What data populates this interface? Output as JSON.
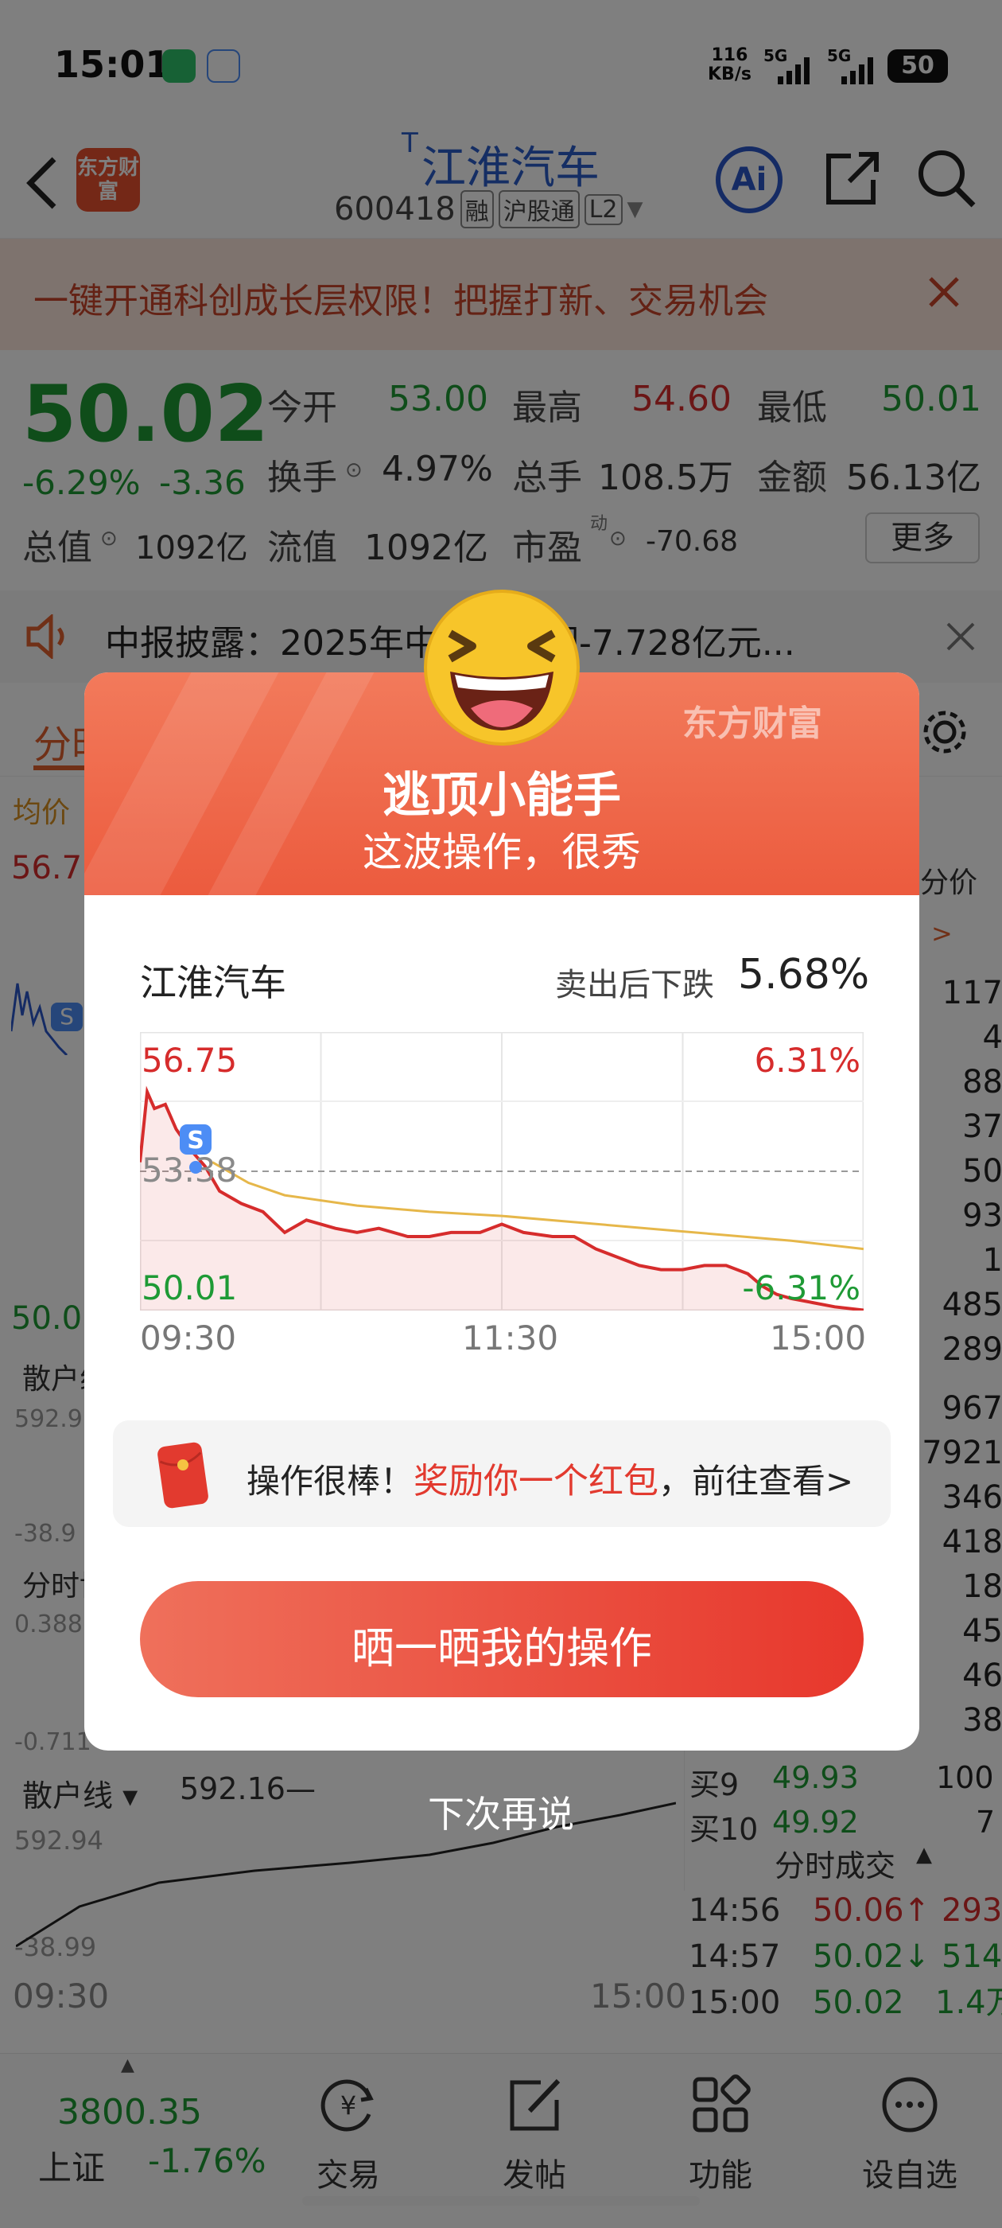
{
  "status_bar": {
    "time": "15:01",
    "net_speed_value": "116",
    "net_speed_unit": "KB/s",
    "signal1": "5G",
    "signal2": "5G",
    "battery": "50"
  },
  "header": {
    "logo_text": "东方财富",
    "title_prefix": "T",
    "title": "江淮汽车",
    "code": "600418",
    "badge1": "融",
    "badge2": "沪股通",
    "badge3": "L2"
  },
  "banner": {
    "text": "一键开通科创成长层权限！把握打新、交易机会"
  },
  "quote": {
    "price": "50.02",
    "change_pct": "-6.29%",
    "change_val": "-3.36",
    "open_label": "今开",
    "open": "53.00",
    "high_label": "最高",
    "high": "54.60",
    "low_label": "最低",
    "low": "50.01",
    "turnover_label": "换手",
    "turnover": "4.97%",
    "volume_label": "总手",
    "volume": "108.5万",
    "amount_label": "金额",
    "amount": "56.13亿",
    "mktcap_label": "总值",
    "mktcap": "1092亿",
    "float_label": "流值",
    "float_cap": "1092亿",
    "pe_label": "市盈",
    "pe_sup": "动",
    "pe": "-70.68",
    "more": "更多"
  },
  "notice": {
    "text": "中报披露：2025年中报净利润-7.728亿元..."
  },
  "background_panel": {
    "tab_left": "分时",
    "avg_price": "均价",
    "level_high": "56.7",
    "level_low": "50.0",
    "retail": "散户线",
    "level_592": "592.9",
    "level_neg38": "-38.9",
    "game": "分时博",
    "level_0388": "0.388",
    "level_neg0711": "-0.711",
    "retail_line_label": "散户线 ▾",
    "retail_line_value": "592.16—",
    "retail_top": "592.94",
    "retail_bottom": "-38.99",
    "time_start": "09:30",
    "time_end": "15:00",
    "right_header": "分价",
    "right_arrow": ">",
    "right_values": [
      "117",
      "4",
      "88",
      "37",
      "50",
      "93",
      "1",
      "485",
      "289",
      "967",
      "7921",
      "346",
      "418",
      "18",
      "45",
      "46",
      "38"
    ],
    "buy9_label": "买9",
    "buy9_price": "49.93",
    "buy9_vol": "100",
    "buy10_label": "买10",
    "buy10_price": "49.92",
    "buy10_vol": "7",
    "ticks_title": "分时成交",
    "ticks": [
      {
        "time": "14:56",
        "price": "50.06",
        "dir": "↑",
        "vol": "293"
      },
      {
        "time": "14:57",
        "price": "50.02",
        "dir": "↓",
        "vol": "514"
      },
      {
        "time": "15:00",
        "price": "50.02",
        "dir": "",
        "vol": "1.4万"
      }
    ]
  },
  "bottom_nav": {
    "index_value": "3800.35",
    "index_name": "上证",
    "index_change": "-1.76%",
    "items": [
      {
        "label": "交易",
        "icon": "yen-refresh-icon"
      },
      {
        "label": "发帖",
        "icon": "edit-post-icon"
      },
      {
        "label": "功能",
        "icon": "grid-apps-icon"
      },
      {
        "label": "设自选",
        "icon": "more-dots-icon"
      }
    ]
  },
  "modal": {
    "brand": "东方财富",
    "title": "逃顶小能手",
    "subtitle": "这波操作，很秀",
    "stock_name": "江淮汽车",
    "drop_label": "卖出后下跌",
    "drop_value": "5.68%",
    "chart_top_left": "56.75",
    "chart_top_right": "6.31%",
    "chart_mid_left": "53.38",
    "chart_bottom_left": "50.01",
    "chart_bottom_right": "-6.31%",
    "sell_marker": "S",
    "axis_start": "09:30",
    "axis_mid": "11:30",
    "axis_end": "15:00",
    "reward_prefix": "操作很棒！",
    "reward_highlight": "奖励你一个红包",
    "reward_suffix": "，前往查看>",
    "cta": "晒一晒我的操作",
    "dismiss": "下次再说"
  },
  "chart_data": {
    "type": "line",
    "ylim": [
      50.01,
      56.75
    ],
    "reference_price": 53.38,
    "x_ticks": [
      "09:30",
      "11:30",
      "15:00"
    ],
    "series": [
      {
        "color": "#d62c2c",
        "points": [
          [
            0,
            53.6
          ],
          [
            0.01,
            55.3
          ],
          [
            0.02,
            54.9
          ],
          [
            0.035,
            55.0
          ],
          [
            0.05,
            54.4
          ],
          [
            0.07,
            53.9
          ],
          [
            0.09,
            53.5
          ],
          [
            0.11,
            52.9
          ],
          [
            0.14,
            52.6
          ],
          [
            0.17,
            52.4
          ],
          [
            0.2,
            51.9
          ],
          [
            0.23,
            52.2
          ],
          [
            0.27,
            52.0
          ],
          [
            0.3,
            51.9
          ],
          [
            0.33,
            52.0
          ],
          [
            0.37,
            51.8
          ],
          [
            0.4,
            51.8
          ],
          [
            0.43,
            51.9
          ],
          [
            0.47,
            51.9
          ],
          [
            0.5,
            52.1
          ],
          [
            0.53,
            51.9
          ],
          [
            0.57,
            51.8
          ],
          [
            0.6,
            51.8
          ],
          [
            0.63,
            51.5
          ],
          [
            0.66,
            51.3
          ],
          [
            0.69,
            51.1
          ],
          [
            0.72,
            51.0
          ],
          [
            0.75,
            51.0
          ],
          [
            0.78,
            51.1
          ],
          [
            0.81,
            51.1
          ],
          [
            0.84,
            50.9
          ],
          [
            0.86,
            50.6
          ],
          [
            0.88,
            50.4
          ],
          [
            0.9,
            50.3
          ],
          [
            0.93,
            50.2
          ],
          [
            0.96,
            50.1
          ],
          [
            1.0,
            50.02
          ]
        ]
      },
      {
        "color": "#e6b74a",
        "points": [
          [
            0.1,
            53.6
          ],
          [
            0.15,
            53.1
          ],
          [
            0.2,
            52.8
          ],
          [
            0.3,
            52.55
          ],
          [
            0.4,
            52.4
          ],
          [
            0.5,
            52.3
          ],
          [
            0.6,
            52.15
          ],
          [
            0.7,
            52.0
          ],
          [
            0.8,
            51.85
          ],
          [
            0.9,
            51.7
          ],
          [
            1.0,
            51.5
          ]
        ]
      }
    ]
  }
}
